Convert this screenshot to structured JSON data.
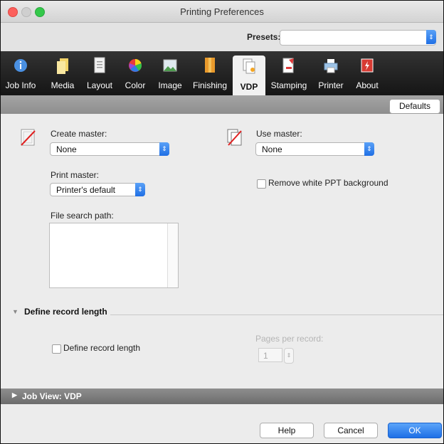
{
  "window": {
    "title": "Printing Preferences"
  },
  "presets": {
    "label": "Presets:",
    "value": ""
  },
  "tabs": [
    {
      "label": "Job Info",
      "icon": "info-icon"
    },
    {
      "label": "Media",
      "icon": "media-icon"
    },
    {
      "label": "Layout",
      "icon": "layout-icon"
    },
    {
      "label": "Color",
      "icon": "color-wheel-icon"
    },
    {
      "label": "Image",
      "icon": "image-icon"
    },
    {
      "label": "Finishing",
      "icon": "finishing-icon"
    },
    {
      "label": "VDP",
      "icon": "vdp-icon",
      "active": true
    },
    {
      "label": "Stamping",
      "icon": "stamping-icon"
    },
    {
      "label": "Printer",
      "icon": "printer-icon"
    },
    {
      "label": "About",
      "icon": "about-icon"
    }
  ],
  "defaults_label": "Defaults",
  "create_master": {
    "label": "Create master:",
    "value": "None"
  },
  "use_master": {
    "label": "Use master:",
    "value": "None"
  },
  "print_master": {
    "label": "Print master:",
    "value": "Printer's default"
  },
  "remove_white": {
    "label": "Remove white PPT background",
    "checked": false
  },
  "file_search": {
    "label": "File search path:"
  },
  "record_section": {
    "title": "Define record length",
    "checkbox_label": "Define record length",
    "checked": false
  },
  "pages_per_record": {
    "label": "Pages per record:",
    "value": "1"
  },
  "job_view": {
    "label": "Job View: VDP"
  },
  "buttons": {
    "help": "Help",
    "cancel": "Cancel",
    "ok": "OK"
  },
  "colors": {
    "accent": "#1e6fe6",
    "toolbar": "#1c1c1c"
  }
}
